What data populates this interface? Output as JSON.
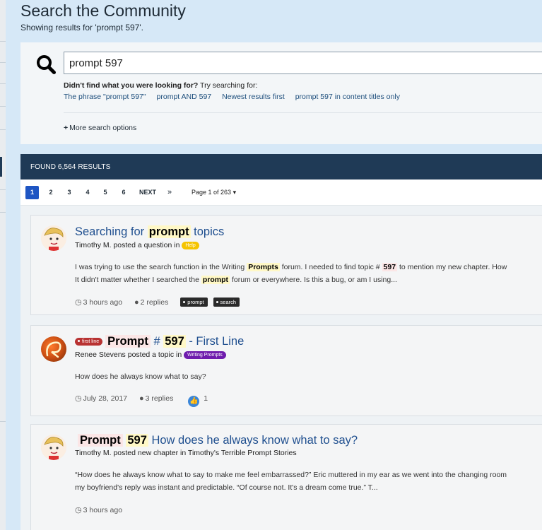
{
  "header": {
    "title": "Search the Community",
    "subtitle": "Showing results for 'prompt 597'."
  },
  "search": {
    "value": "prompt 597",
    "hint_bold": "Didn't find what you were looking for?",
    "hint_rest": " Try searching for:",
    "suggestions": [
      "The phrase \"prompt 597\"",
      "prompt AND 597",
      "Newest results first",
      "prompt 597 in content titles only"
    ],
    "more_options": "More search options"
  },
  "results": {
    "count_label": "FOUND 6,564 RESULTS"
  },
  "pagination": {
    "pages": [
      "1",
      "2",
      "3",
      "4",
      "5",
      "6"
    ],
    "active_page": 1,
    "next": "NEXT",
    "last": "»",
    "page_of": "Page 1 of 263"
  },
  "items": [
    {
      "title_pre": "Searching for ",
      "title_hl": "prompt",
      "title_post": " topics",
      "author": "Timothy M.",
      "action": " posted a question in ",
      "forum": "Help",
      "snippet1_a": "I was trying to use the search function in the Writing ",
      "snippet1_hl1": "Prompts",
      "snippet1_b": " forum. I needed to find topic # ",
      "snippet1_hl2": "597",
      "snippet1_c": " to mention my new chapter. How",
      "snippet2_a": "It didn't matter whether I searched the ",
      "snippet2_hl": "prompt",
      "snippet2_b": " forum or everywhere. Is this a bug, or am I using...",
      "time": "3 hours ago",
      "replies": "2 replies",
      "tags": [
        "prompt",
        "search"
      ]
    },
    {
      "prefix": "first line",
      "title_hl1": "Prompt",
      "title_mid": " # ",
      "title_hl2": "597",
      "title_post": " - First Line",
      "author": "Renee Stevens",
      "action": " posted a topic in ",
      "forum": "Writing Prompts",
      "snippet": "How does he always know what to say?",
      "time": "July 28, 2017",
      "replies": "3 replies",
      "reactions": "1"
    },
    {
      "title_hl1": "Prompt",
      "title_hl2": "597",
      "title_post": " How does he always know what to say?",
      "author": "Timothy M.",
      "action": " posted new chapter in ",
      "container": "Timothy's Terrible Prompt Stories",
      "snippet1": "“How does he always know what to say to make me feel embarrassed?” Eric muttered in my ear as we went into the changing room",
      "snippet2": "my boyfriend's reply was instant and predictable. “Of course not. It's a dream come true.” T...",
      "time": "3 hours ago"
    }
  ]
}
